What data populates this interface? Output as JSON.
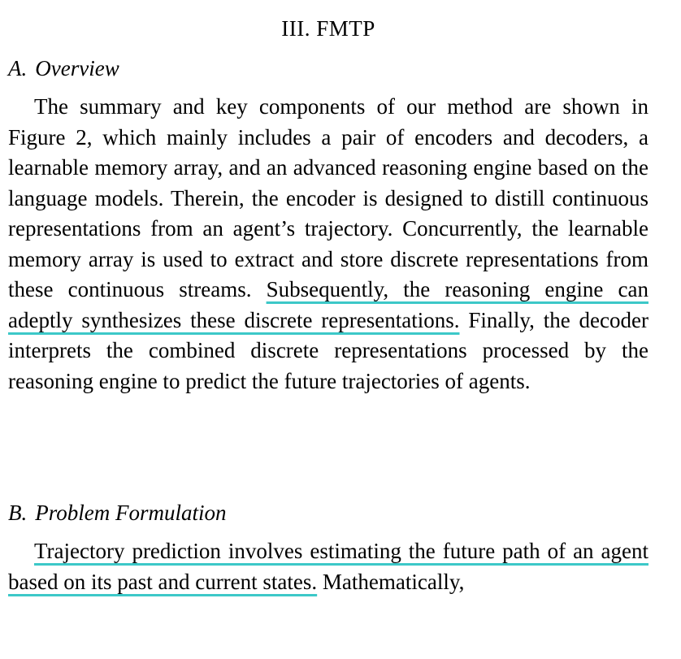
{
  "section": {
    "title": "III. FMTP"
  },
  "overview": {
    "label": "A.",
    "heading": "Overview",
    "text_before_highlight": "The summary and key components of our method are shown in Figure 2, which mainly includes a pair of encoders and decoders, a learnable memory array, and an advanced reasoning engine based on the language models. Therein, the encoder is designed to distill continuous representations from an agent’s trajectory. Concurrently, the learnable memory array is used to extract and store discrete representations from these continuous streams. ",
    "highlight": "Subsequently, the reasoning engine can adeptly synthesizes these discrete representations.",
    "text_after_highlight": " Finally, the decoder interprets the combined discrete representations pro­cessed by the reasoning engine to predict the future trajectories of agents."
  },
  "problem": {
    "label": "B.",
    "heading": "Problem Formulation",
    "highlight": "Trajectory prediction involves estimating the future path of an agent based on its past and current states.",
    "text_after_highlight": " Mathematically,"
  },
  "colors": {
    "highlight_underline": "#3cc8c8"
  }
}
